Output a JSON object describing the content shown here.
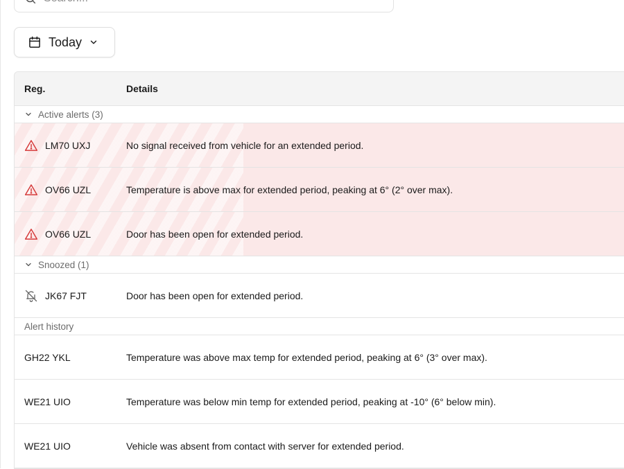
{
  "search": {
    "placeholder": "Search..."
  },
  "date_filter": {
    "label": "Today"
  },
  "table": {
    "headers": {
      "reg": "Reg.",
      "details": "Details"
    },
    "groups": {
      "active": {
        "label": "Active alerts (3)",
        "rows": [
          {
            "reg": "LM70 UXJ",
            "details": "No signal received from vehicle for an extended period.",
            "icon": "warning-triangle-icon"
          },
          {
            "reg": "OV66 UZL",
            "details": "Temperature is above max for extended period, peaking at 6°  (2° over max).",
            "icon": "warning-triangle-icon"
          },
          {
            "reg": "OV66 UZL",
            "details": "Door has been open for extended period.",
            "icon": "warning-triangle-icon"
          }
        ]
      },
      "snoozed": {
        "label": "Snoozed (1)",
        "rows": [
          {
            "reg": "JK67 FJT",
            "details": "Door has been open for extended period.",
            "icon": "bell-off-icon"
          }
        ]
      },
      "history": {
        "label": "Alert history",
        "rows": [
          {
            "reg": "GH22 YKL",
            "details": "Temperature was above max temp for extended period, peaking at 6°  (3° over max)."
          },
          {
            "reg": "WE21 UIO",
            "details": "Temperature was below min temp for extended period, peaking at -10°  (6° below min)."
          },
          {
            "reg": "WE21 UIO",
            "details": "Vehicle was absent from contact with server for extended period."
          }
        ]
      }
    }
  },
  "colors": {
    "alert_row_bg": "#fbe8e8",
    "alert_icon": "#d63b3b",
    "header_bg": "#f4f4f4",
    "border": "#e4e4e4",
    "muted_text": "#6b6b6b"
  }
}
